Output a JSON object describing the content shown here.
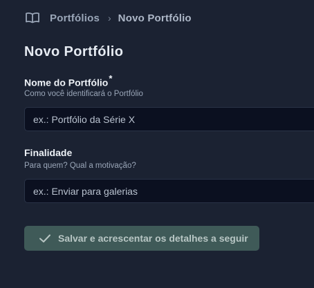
{
  "breadcrumb": {
    "icon": "book-open-icon",
    "items": [
      "Portfólios",
      "Novo Portfólio"
    ],
    "separator": "›"
  },
  "page": {
    "title": "Novo Portfólio"
  },
  "form": {
    "name_field": {
      "label": "Nome do Portfólio",
      "required_mark": "*",
      "hint": "Como você identificará o Portfólio",
      "placeholder": "ex.: Portfólio da Série X",
      "value": ""
    },
    "purpose_field": {
      "label": "Finalidade",
      "hint": "Para quem? Qual a motivação?",
      "placeholder": "ex.: Enviar para galerias",
      "value": ""
    },
    "save_button": {
      "icon": "check-icon",
      "label": "Salvar e acrescentar os detalhes a seguir"
    }
  },
  "colors": {
    "background": "#1b2232",
    "input_background": "#0b1020",
    "button_background": "#3f5a58",
    "button_text": "#b8c6c4"
  }
}
